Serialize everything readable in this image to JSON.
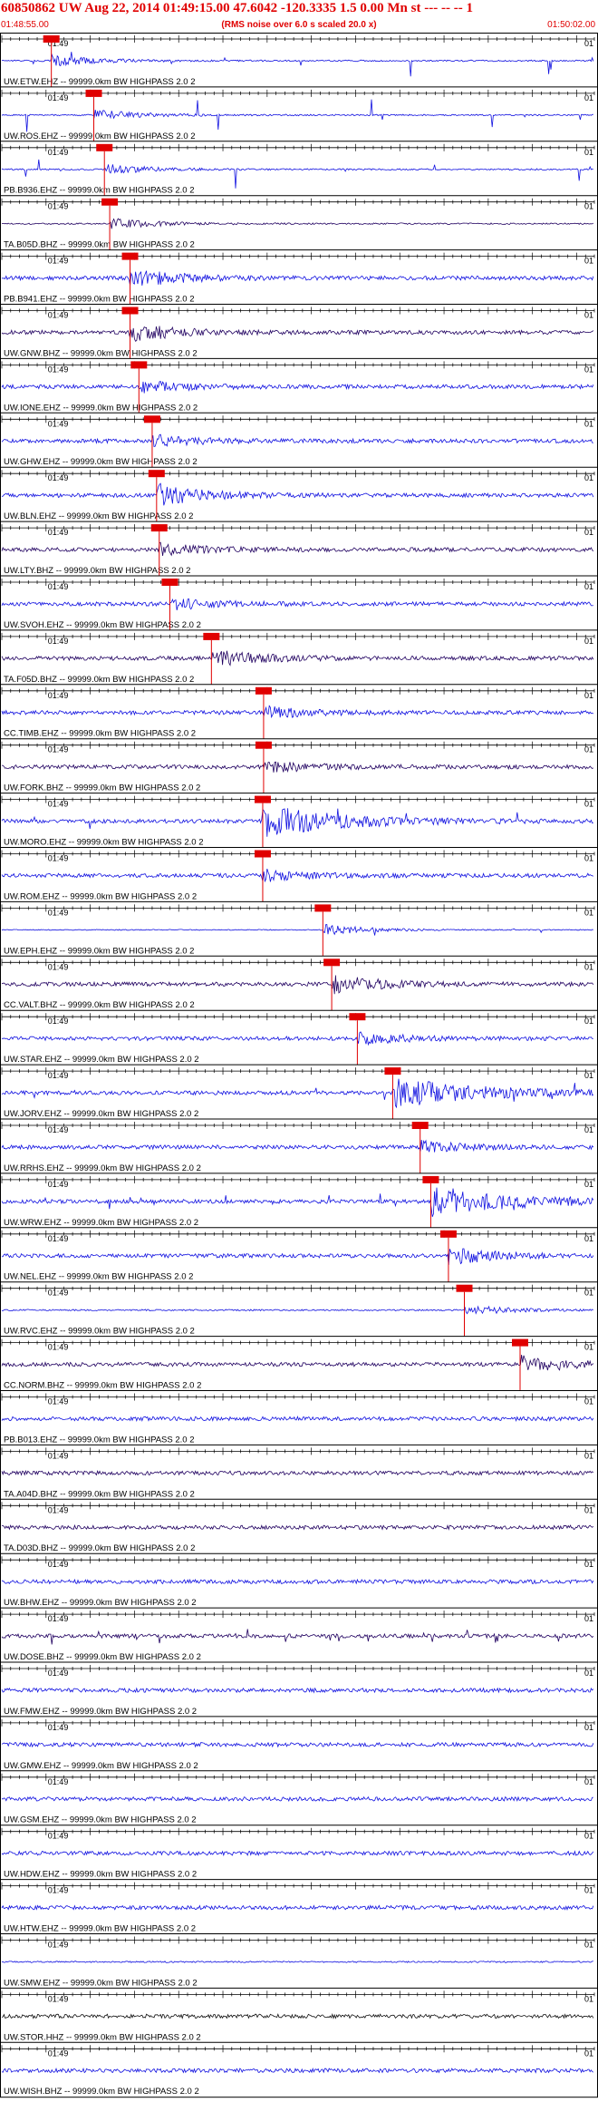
{
  "header": {
    "title": "60850862 UW Aug 22, 2014 01:49:15.00   47.6042 -120.3335  1.5 0.00 Mn st --- -- --  1",
    "subtitle": "(RMS noise over 6.0 s scaled 20.0 x)",
    "start_time": "01:48:55.00",
    "end_time": "01:50:02.00"
  },
  "colors": {
    "header_text": "#e00000",
    "pick_box": "#e00000",
    "pick_line": "#e00000",
    "trace_blue": "#1010e0",
    "trace_dark": "#200060"
  },
  "chart_data": {
    "type": "line",
    "title": "60850862 UW Aug 22, 2014 01:49:15.00   47.6042 -120.3335  1.5 0.00 Mn st --- -- --  1",
    "subtitle": "(RMS noise over 6.0 s scaled 20.0 x)",
    "x_start": "01:48:55.00",
    "x_end": "01:50:02.00",
    "tick_left_label": "01:49",
    "tick_right_label": "01",
    "traces": [
      {
        "label": "UW.ETW.EHZ -- 99999.0km BW  HIGHPASS  2.0  2",
        "pick": 5.6,
        "style": "spiky",
        "color": "blue"
      },
      {
        "label": "UW.ROS.EHZ -- 99999.0km BW  HIGHPASS  2.0  2",
        "pick": 10.4,
        "style": "spiky",
        "color": "blue"
      },
      {
        "label": "PB.B936.EHZ -- 99999.0km BW  HIGHPASS  2.0  2",
        "pick": 11.6,
        "style": "spiky",
        "color": "blue"
      },
      {
        "label": "TA.B05D.BHZ -- 99999.0km BW  HIGHPASS  2.0  2",
        "pick": 12.2,
        "style": "quiet",
        "color": "dark"
      },
      {
        "label": "PB.B941.EHZ -- 99999.0km BW  HIGHPASS  2.0  2",
        "pick": 14.5,
        "style": "event",
        "color": "blue"
      },
      {
        "label": "UW.GNW.BHZ -- 99999.0km BW  HIGHPASS  2.0  2",
        "pick": 14.5,
        "style": "event",
        "color": "dark"
      },
      {
        "label": "UW.IONE.EHZ -- 99999.0km BW  HIGHPASS  2.0  2",
        "pick": 15.5,
        "style": "noise",
        "color": "blue"
      },
      {
        "label": "UW.GHW.EHZ -- 99999.0km BW  HIGHPASS  2.0  2",
        "pick": 17.0,
        "style": "noise",
        "color": "blue"
      },
      {
        "label": "UW.BLN.EHZ -- 99999.0km BW  HIGHPASS  2.0  2",
        "pick": 17.5,
        "style": "burst",
        "color": "blue"
      },
      {
        "label": "UW.LTY.BHZ -- 99999.0km BW  HIGHPASS  2.0  2",
        "pick": 17.8,
        "style": "noise",
        "color": "dark"
      },
      {
        "label": "UW.SVOH.EHZ -- 99999.0km BW  HIGHPASS  2.0  2",
        "pick": 19.0,
        "style": "noise",
        "color": "blue"
      },
      {
        "label": "TA.F05D.BHZ -- 99999.0km BW  HIGHPASS  2.0  2",
        "pick": 23.7,
        "style": "event",
        "color": "dark"
      },
      {
        "label": "CC.TIMB.EHZ -- 99999.0km BW  HIGHPASS  2.0  2",
        "pick": 29.6,
        "style": "noise",
        "color": "blue"
      },
      {
        "label": "UW.FORK.BHZ -- 99999.0km BW  HIGHPASS  2.0  2",
        "pick": 29.6,
        "style": "noise",
        "color": "dark"
      },
      {
        "label": "UW.MORO.EHZ -- 99999.0km BW  HIGHPASS  2.0  2",
        "pick": 29.5,
        "style": "heavy",
        "color": "blue"
      },
      {
        "label": "UW.ROM.EHZ -- 99999.0km BW  HIGHPASS  2.0  2",
        "pick": 29.5,
        "style": "noise",
        "color": "blue"
      },
      {
        "label": "UW.EPH.EHZ -- 99999.0km BW  HIGHPASS  2.0  2",
        "pick": 36.3,
        "style": "sparse",
        "color": "blue"
      },
      {
        "label": "CC.VALT.BHZ -- 99999.0km BW  HIGHPASS  2.0  2",
        "pick": 37.3,
        "style": "event",
        "color": "dark"
      },
      {
        "label": "UW.STAR.EHZ -- 99999.0km BW  HIGHPASS  2.0  2",
        "pick": 40.2,
        "style": "noise",
        "color": "blue"
      },
      {
        "label": "UW.JORV.EHZ -- 99999.0km BW  HIGHPASS  2.0  2",
        "pick": 44.2,
        "style": "heavy",
        "color": "blue"
      },
      {
        "label": "UW.RRHS.EHZ -- 99999.0km BW  HIGHPASS  2.0  2",
        "pick": 47.3,
        "style": "noise",
        "color": "blue"
      },
      {
        "label": "UW.WRW.EHZ -- 99999.0km BW  HIGHPASS  2.0  2",
        "pick": 48.5,
        "style": "heavy",
        "color": "blue"
      },
      {
        "label": "UW.NEL.EHZ -- 99999.0km BW  HIGHPASS  2.0  2",
        "pick": 50.5,
        "style": "event",
        "color": "blue"
      },
      {
        "label": "UW.RVC.EHZ -- 99999.0km BW  HIGHPASS  2.0  2",
        "pick": 52.3,
        "style": "quiet",
        "color": "blue"
      },
      {
        "label": "CC.NORM.BHZ -- 99999.0km BW  HIGHPASS  2.0  2",
        "pick": 58.6,
        "style": "event",
        "color": "dark"
      },
      {
        "label": "PB.B013.EHZ -- 99999.0km BW  HIGHPASS  2.0  2",
        "pick": null,
        "style": "noise",
        "color": "blue"
      },
      {
        "label": "TA.A04D.BHZ -- 99999.0km BW  HIGHPASS  2.0  2",
        "pick": null,
        "style": "noise",
        "color": "dark"
      },
      {
        "label": "TA.D03D.BHZ -- 99999.0km BW  HIGHPASS  2.0  2",
        "pick": null,
        "style": "noise",
        "color": "dark"
      },
      {
        "label": "UW.BHW.EHZ -- 99999.0km BW  HIGHPASS  2.0  2",
        "pick": null,
        "style": "noise",
        "color": "blue"
      },
      {
        "label": "UW.DOSE.BHZ -- 99999.0km BW  HIGHPASS  2.0  2",
        "pick": null,
        "style": "heavy",
        "color": "dark"
      },
      {
        "label": "UW.FMW.EHZ -- 99999.0km BW  HIGHPASS  2.0  2",
        "pick": null,
        "style": "noise",
        "color": "blue"
      },
      {
        "label": "UW.GMW.EHZ -- 99999.0km BW  HIGHPASS  2.0  2",
        "pick": null,
        "style": "noise",
        "color": "blue"
      },
      {
        "label": "UW.GSM.EHZ -- 99999.0km BW  HIGHPASS  2.0  2",
        "pick": null,
        "style": "noise",
        "color": "blue"
      },
      {
        "label": "UW.HDW.EHZ -- 99999.0km BW  HIGHPASS  2.0  2",
        "pick": null,
        "style": "noise",
        "color": "blue"
      },
      {
        "label": "UW.HTW.EHZ -- 99999.0km BW  HIGHPASS  2.0  2",
        "pick": null,
        "style": "noise",
        "color": "blue"
      },
      {
        "label": "UW.SMW.EHZ -- 99999.0km BW  HIGHPASS  2.0  2",
        "pick": null,
        "style": "quiet",
        "color": "blue"
      },
      {
        "label": "UW.STOR.HHZ -- 99999.0km BW  HIGHPASS  2.0  2",
        "pick": null,
        "style": "noise",
        "color": "black"
      },
      {
        "label": "UW.WISH.BHZ -- 99999.0km BW  HIGHPASS  2.0  2",
        "pick": null,
        "style": "noise",
        "color": "blue"
      }
    ]
  }
}
